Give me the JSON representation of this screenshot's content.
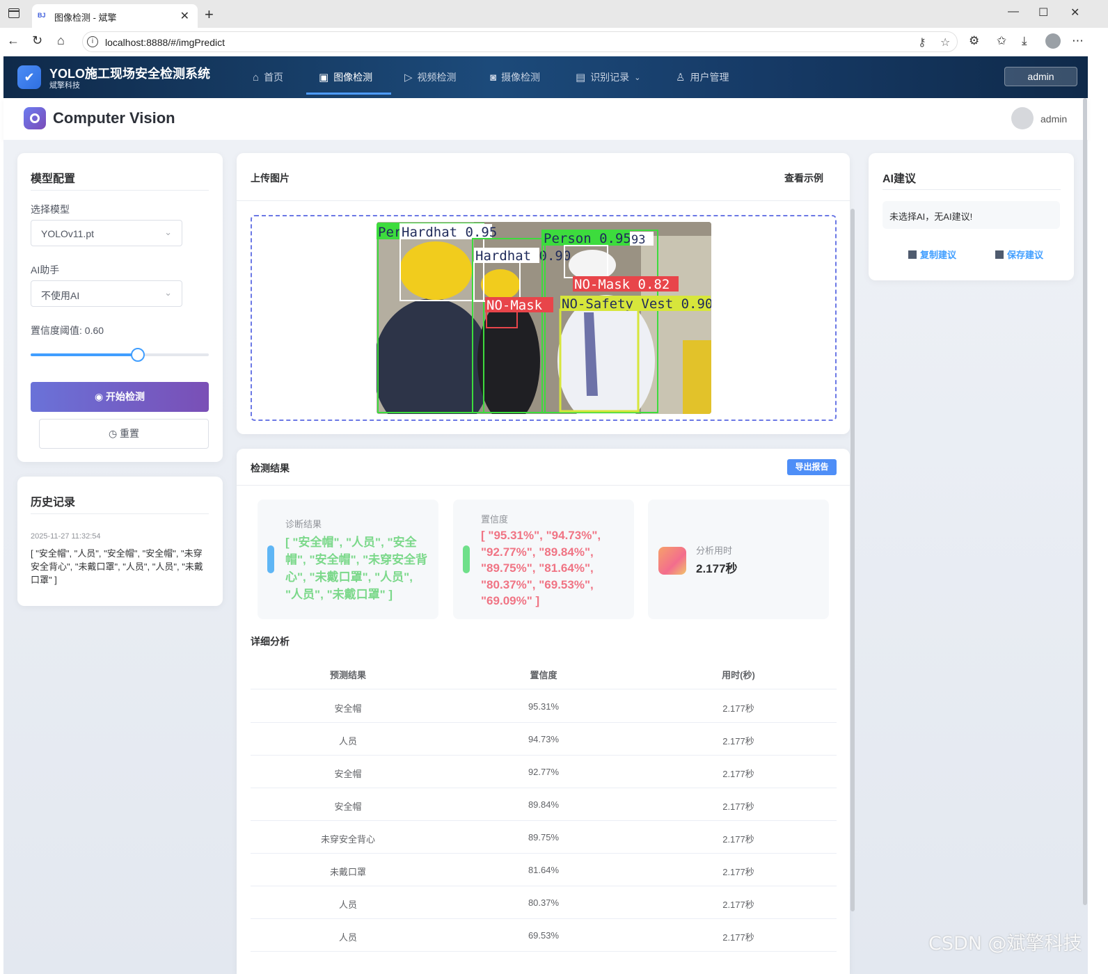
{
  "browser": {
    "tab_title": "图像检测 - 斌擎",
    "favicon_text": "BJ",
    "url": "localhost:8888/#/imgPredict"
  },
  "header": {
    "app_title": "YOLO施工现场安全检测系统",
    "app_subtitle": "斌擎科技",
    "menu": [
      {
        "label": "首页",
        "icon": "home-icon"
      },
      {
        "label": "图像检测",
        "icon": "image-icon",
        "active": true
      },
      {
        "label": "视频检测",
        "icon": "play-icon"
      },
      {
        "label": "摄像检测",
        "icon": "camera-icon"
      },
      {
        "label": "识别记录",
        "icon": "document-icon"
      },
      {
        "label": "用户管理",
        "icon": "user-icon"
      }
    ],
    "user_button": "admin"
  },
  "page_header": {
    "title": "Computer Vision",
    "user": "admin"
  },
  "config": {
    "title": "模型配置",
    "model_label": "选择模型",
    "model_value": "YOLOv11.pt",
    "ai_label": "AI助手",
    "ai_value": "不使用AI",
    "confidence_label": "置信度阈值: 0.60",
    "confidence_value": 0.6,
    "start_button": "开始检测",
    "reset_button": "重置"
  },
  "history": {
    "title": "历史记录",
    "time": "2025-11-27 11:32:54",
    "text": "[ \"安全帽\", \"人员\", \"安全帽\", \"安全帽\", \"未穿安全背心\", \"未戴口罩\", \"人员\", \"人员\", \"未戴口罩\" ]"
  },
  "upload": {
    "title": "上传图片",
    "example_button": "查看示例",
    "detections": [
      {
        "label": "Person 0.95",
        "color": "#3ddc3d"
      },
      {
        "label": "Hardhat 0.95",
        "color": "#ffffff"
      },
      {
        "label": "Hardhat 0.90",
        "color": "#ffffff"
      },
      {
        "label": "NO-Mask 0.82",
        "color": "#e8454a"
      },
      {
        "label": "NO-Mask",
        "color": "#e8454a"
      },
      {
        "label": "NO-Safety Vest 0.90",
        "color": "#d7e63b"
      }
    ]
  },
  "results": {
    "title": "检测结果",
    "export_button": "导出报告",
    "diagnosis_label": "诊断结果",
    "diagnosis_value": "[ \"安全帽\", \"人员\", \"安全帽\", \"安全帽\", \"未穿安全背心\", \"未戴口罩\", \"人员\", \"人员\", \"未戴口罩\" ]",
    "confidence_label": "置信度",
    "confidence_value": "[ \"95.31%\", \"94.73%\", \"92.77%\", \"89.84%\", \"89.75%\", \"81.64%\", \"80.37%\", \"69.53%\", \"69.09%\" ]",
    "time_label": "分析用时",
    "time_value": "2.177秒",
    "colors": {
      "diagnosis": "#7bd88a",
      "confidence": "#f07484",
      "bar_blue": "#5fb6f5",
      "bar_green": "#6fe08a"
    }
  },
  "detail": {
    "title": "详细分析",
    "columns": [
      "预测结果",
      "置信度",
      "用时(秒)"
    ],
    "rows": [
      [
        "安全帽",
        "95.31%",
        "2.177秒"
      ],
      [
        "人员",
        "94.73%",
        "2.177秒"
      ],
      [
        "安全帽",
        "92.77%",
        "2.177秒"
      ],
      [
        "安全帽",
        "89.84%",
        "2.177秒"
      ],
      [
        "未穿安全背心",
        "89.75%",
        "2.177秒"
      ],
      [
        "未戴口罩",
        "81.64%",
        "2.177秒"
      ],
      [
        "人员",
        "80.37%",
        "2.177秒"
      ],
      [
        "人员",
        "69.53%",
        "2.177秒"
      ]
    ]
  },
  "ai": {
    "title": "AI建议",
    "message": "未选择AI，无AI建议!",
    "copy_button": "复制建议",
    "save_button": "保存建议"
  },
  "watermark": "CSDN @斌擎科技"
}
